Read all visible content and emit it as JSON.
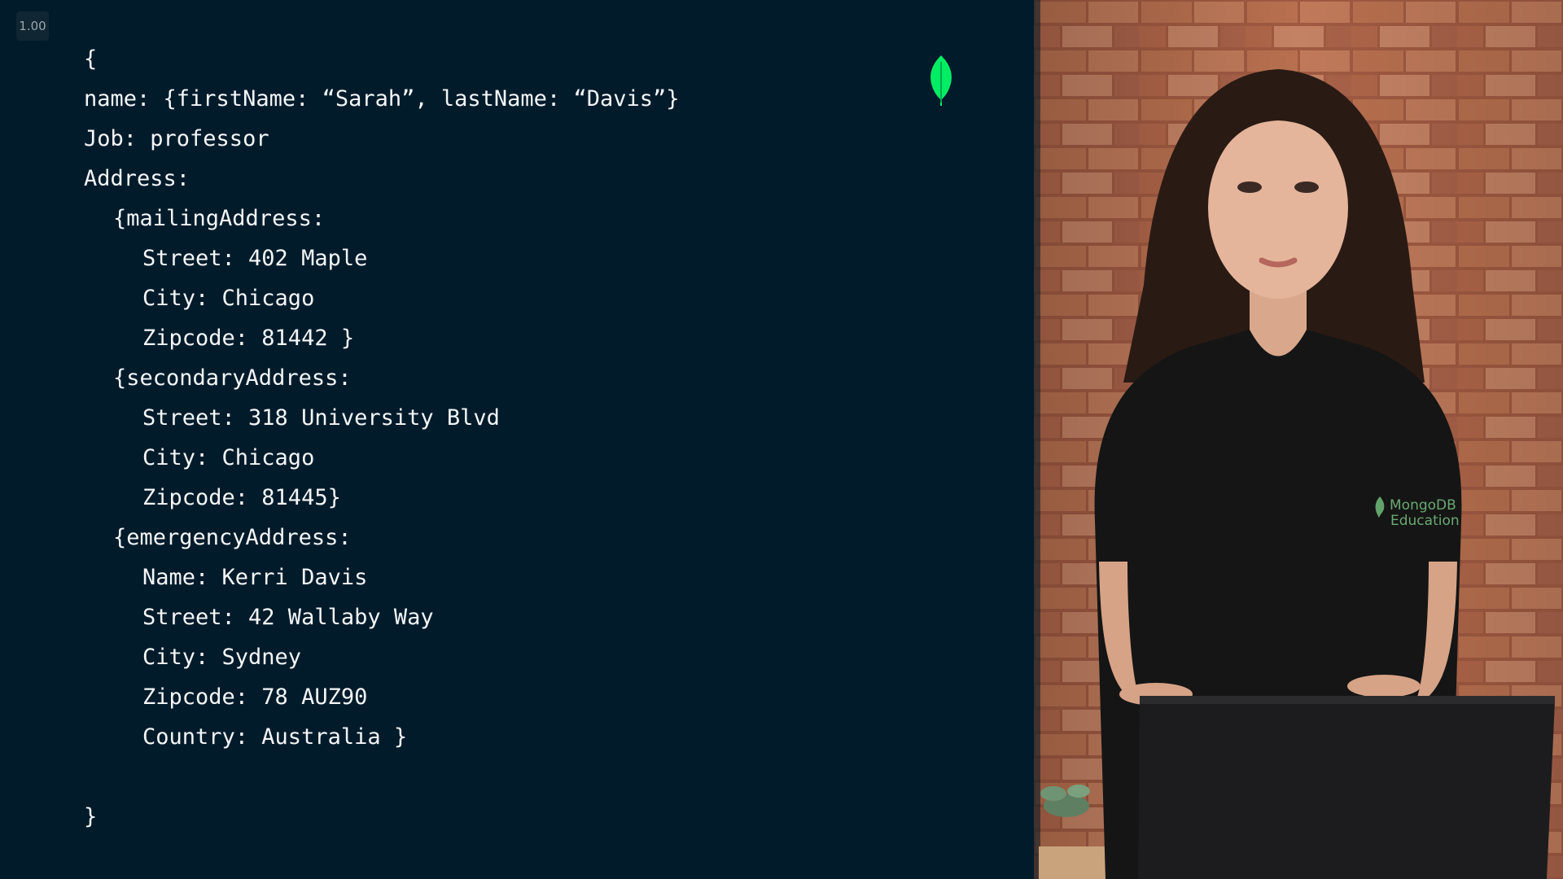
{
  "player": {
    "speed_label": "1.00"
  },
  "slide": {
    "logo_icon": "mongodb-leaf-icon",
    "code_lines": [
      "{",
      "name: {firstName: “Sarah”, lastName: “Davis”}",
      "Job: professor",
      "Address:",
      "{mailingAddress:",
      "Street: 402 Maple",
      "City: Chicago",
      "Zipcode: 81442 }",
      "{secondaryAddress:",
      "Street: 318 University Blvd",
      "City: Chicago",
      "Zipcode: 81445}",
      "{emergencyAddress:",
      "Name: Kerri Davis",
      "Street: 42 Wallaby Way",
      "City: Sydney",
      "Zipcode: 78 AUZ90",
      "Country: Australia }",
      "}"
    ]
  },
  "presenter": {
    "shirt_logo_text_1": "MongoDB",
    "shirt_logo_text_2": "Education"
  },
  "colors": {
    "background": "#011b2b",
    "code_text": "#f4f6f7",
    "leaf_green": "#00ed64",
    "brick": "#b86b4e",
    "shirt": "#151515"
  }
}
